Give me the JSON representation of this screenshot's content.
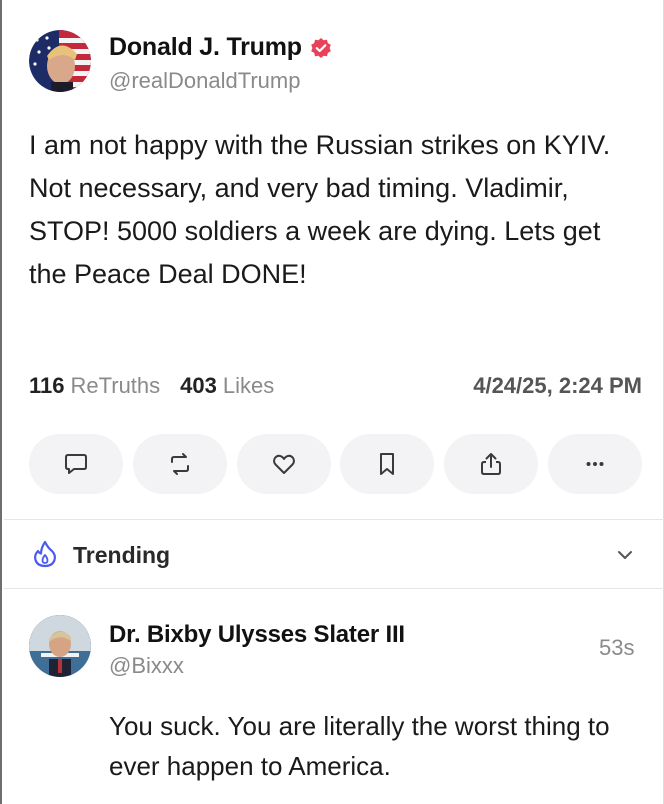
{
  "post": {
    "author_name": "Donald J. Trump",
    "author_handle": "@realDonaldTrump",
    "text": "I am not happy with the Russian strikes on KYIV. Not necessary, and very bad timing. Vladimir, STOP! 5000 soldiers a week are dying. Lets get the Peace Deal DONE!",
    "retruths_count": "116",
    "retruths_label": "ReTruths",
    "likes_count": "403",
    "likes_label": "Likes",
    "timestamp": "4/24/25, 2:24 PM",
    "verified_color": "#e8415a"
  },
  "actions": [
    {
      "icon": "comment-icon"
    },
    {
      "icon": "retruth-icon"
    },
    {
      "icon": "heart-icon"
    },
    {
      "icon": "bookmark-icon"
    },
    {
      "icon": "share-icon"
    },
    {
      "icon": "more-icon"
    }
  ],
  "trending": {
    "label": "Trending",
    "accent_color": "#4a5cf0"
  },
  "reply": {
    "author_name": "Dr. Bixby Ulysses Slater III",
    "author_handle": "@Bixxx",
    "time_ago": "53s",
    "text": "You suck. You are literally the worst thing to ever happen to America."
  }
}
